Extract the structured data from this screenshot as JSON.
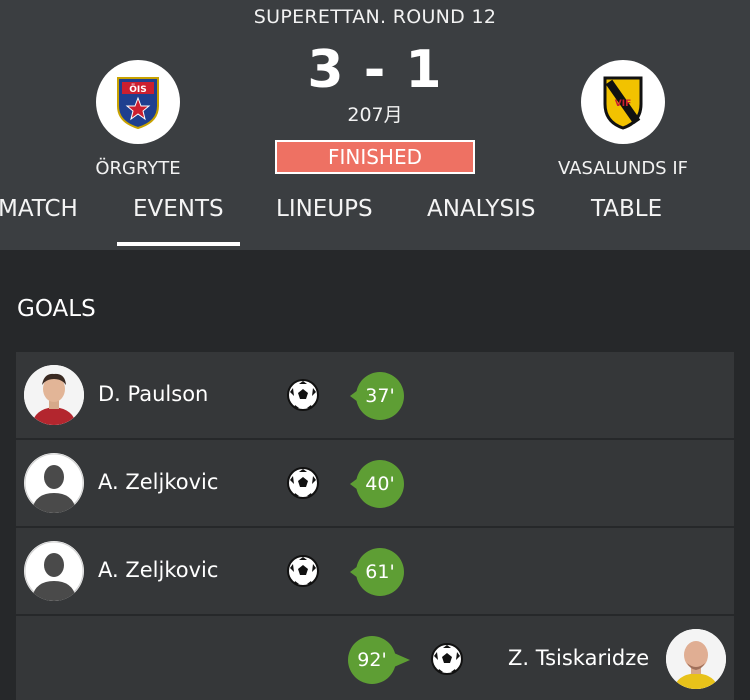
{
  "match": {
    "competition": "SUPERETTAN. ROUND 12",
    "score": "3 - 1",
    "date": "207月",
    "status": "FINISHED",
    "home_team": {
      "name": "ÖRGRYTE",
      "logo_text": "ÖIS"
    },
    "away_team": {
      "name": "VASALUNDS IF",
      "logo_text": "VIF"
    }
  },
  "tabs": [
    {
      "label": "MATCH"
    },
    {
      "label": "EVENTS",
      "active": true
    },
    {
      "label": "LINEUPS"
    },
    {
      "label": "ANALYSIS"
    },
    {
      "label": "TABLE"
    }
  ],
  "goals": {
    "title": "GOALS",
    "items": [
      {
        "player": "D. Paulson",
        "minute": "37'",
        "side": "home",
        "avatar": "player-photo"
      },
      {
        "player": "A. Zeljkovic",
        "minute": "40'",
        "side": "home",
        "avatar": "placeholder"
      },
      {
        "player": "A. Zeljkovic",
        "minute": "61'",
        "side": "home",
        "avatar": "placeholder"
      },
      {
        "player": "Z. Tsiskaridze",
        "minute": "92'",
        "side": "away",
        "avatar": "player-photo"
      }
    ]
  },
  "colors": {
    "header_bg": "#3b3e41",
    "page_bg": "#26282a",
    "row_bg": "#353739",
    "status_bg": "#ee7163",
    "minute_badge": "#5e9e34"
  }
}
